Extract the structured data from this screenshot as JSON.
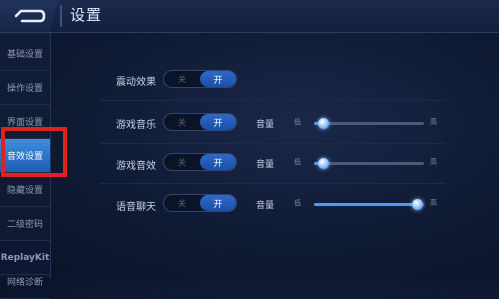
{
  "header": {
    "title": "设置"
  },
  "sidebar": {
    "items": [
      {
        "label": "基础设置"
      },
      {
        "label": "操作设置"
      },
      {
        "label": "界面设置"
      },
      {
        "label": "音效设置",
        "active": true
      },
      {
        "label": "隐藏设置"
      },
      {
        "label": "二级密码"
      },
      {
        "label": "ReplayKit"
      },
      {
        "label": "网络诊断"
      }
    ]
  },
  "settings": {
    "vibration": {
      "label": "震动效果",
      "off": "关",
      "on": "开",
      "state": "on"
    },
    "music": {
      "label": "游戏音乐",
      "off": "关",
      "on": "开",
      "state": "on",
      "volume_label": "音量",
      "low": "低",
      "high": "高",
      "volume": 0.0
    },
    "sfx": {
      "label": "游戏音效",
      "off": "关",
      "on": "开",
      "state": "on",
      "volume_label": "音量",
      "low": "低",
      "high": "高",
      "volume": 0.0
    },
    "voice": {
      "label": "语音聊天",
      "off": "关",
      "on": "开",
      "state": "on",
      "volume_label": "音量",
      "low": "低",
      "high": "高",
      "volume": 1.0
    }
  },
  "colors": {
    "accent": "#4c9bf0",
    "highlight_box": "#e02121"
  }
}
